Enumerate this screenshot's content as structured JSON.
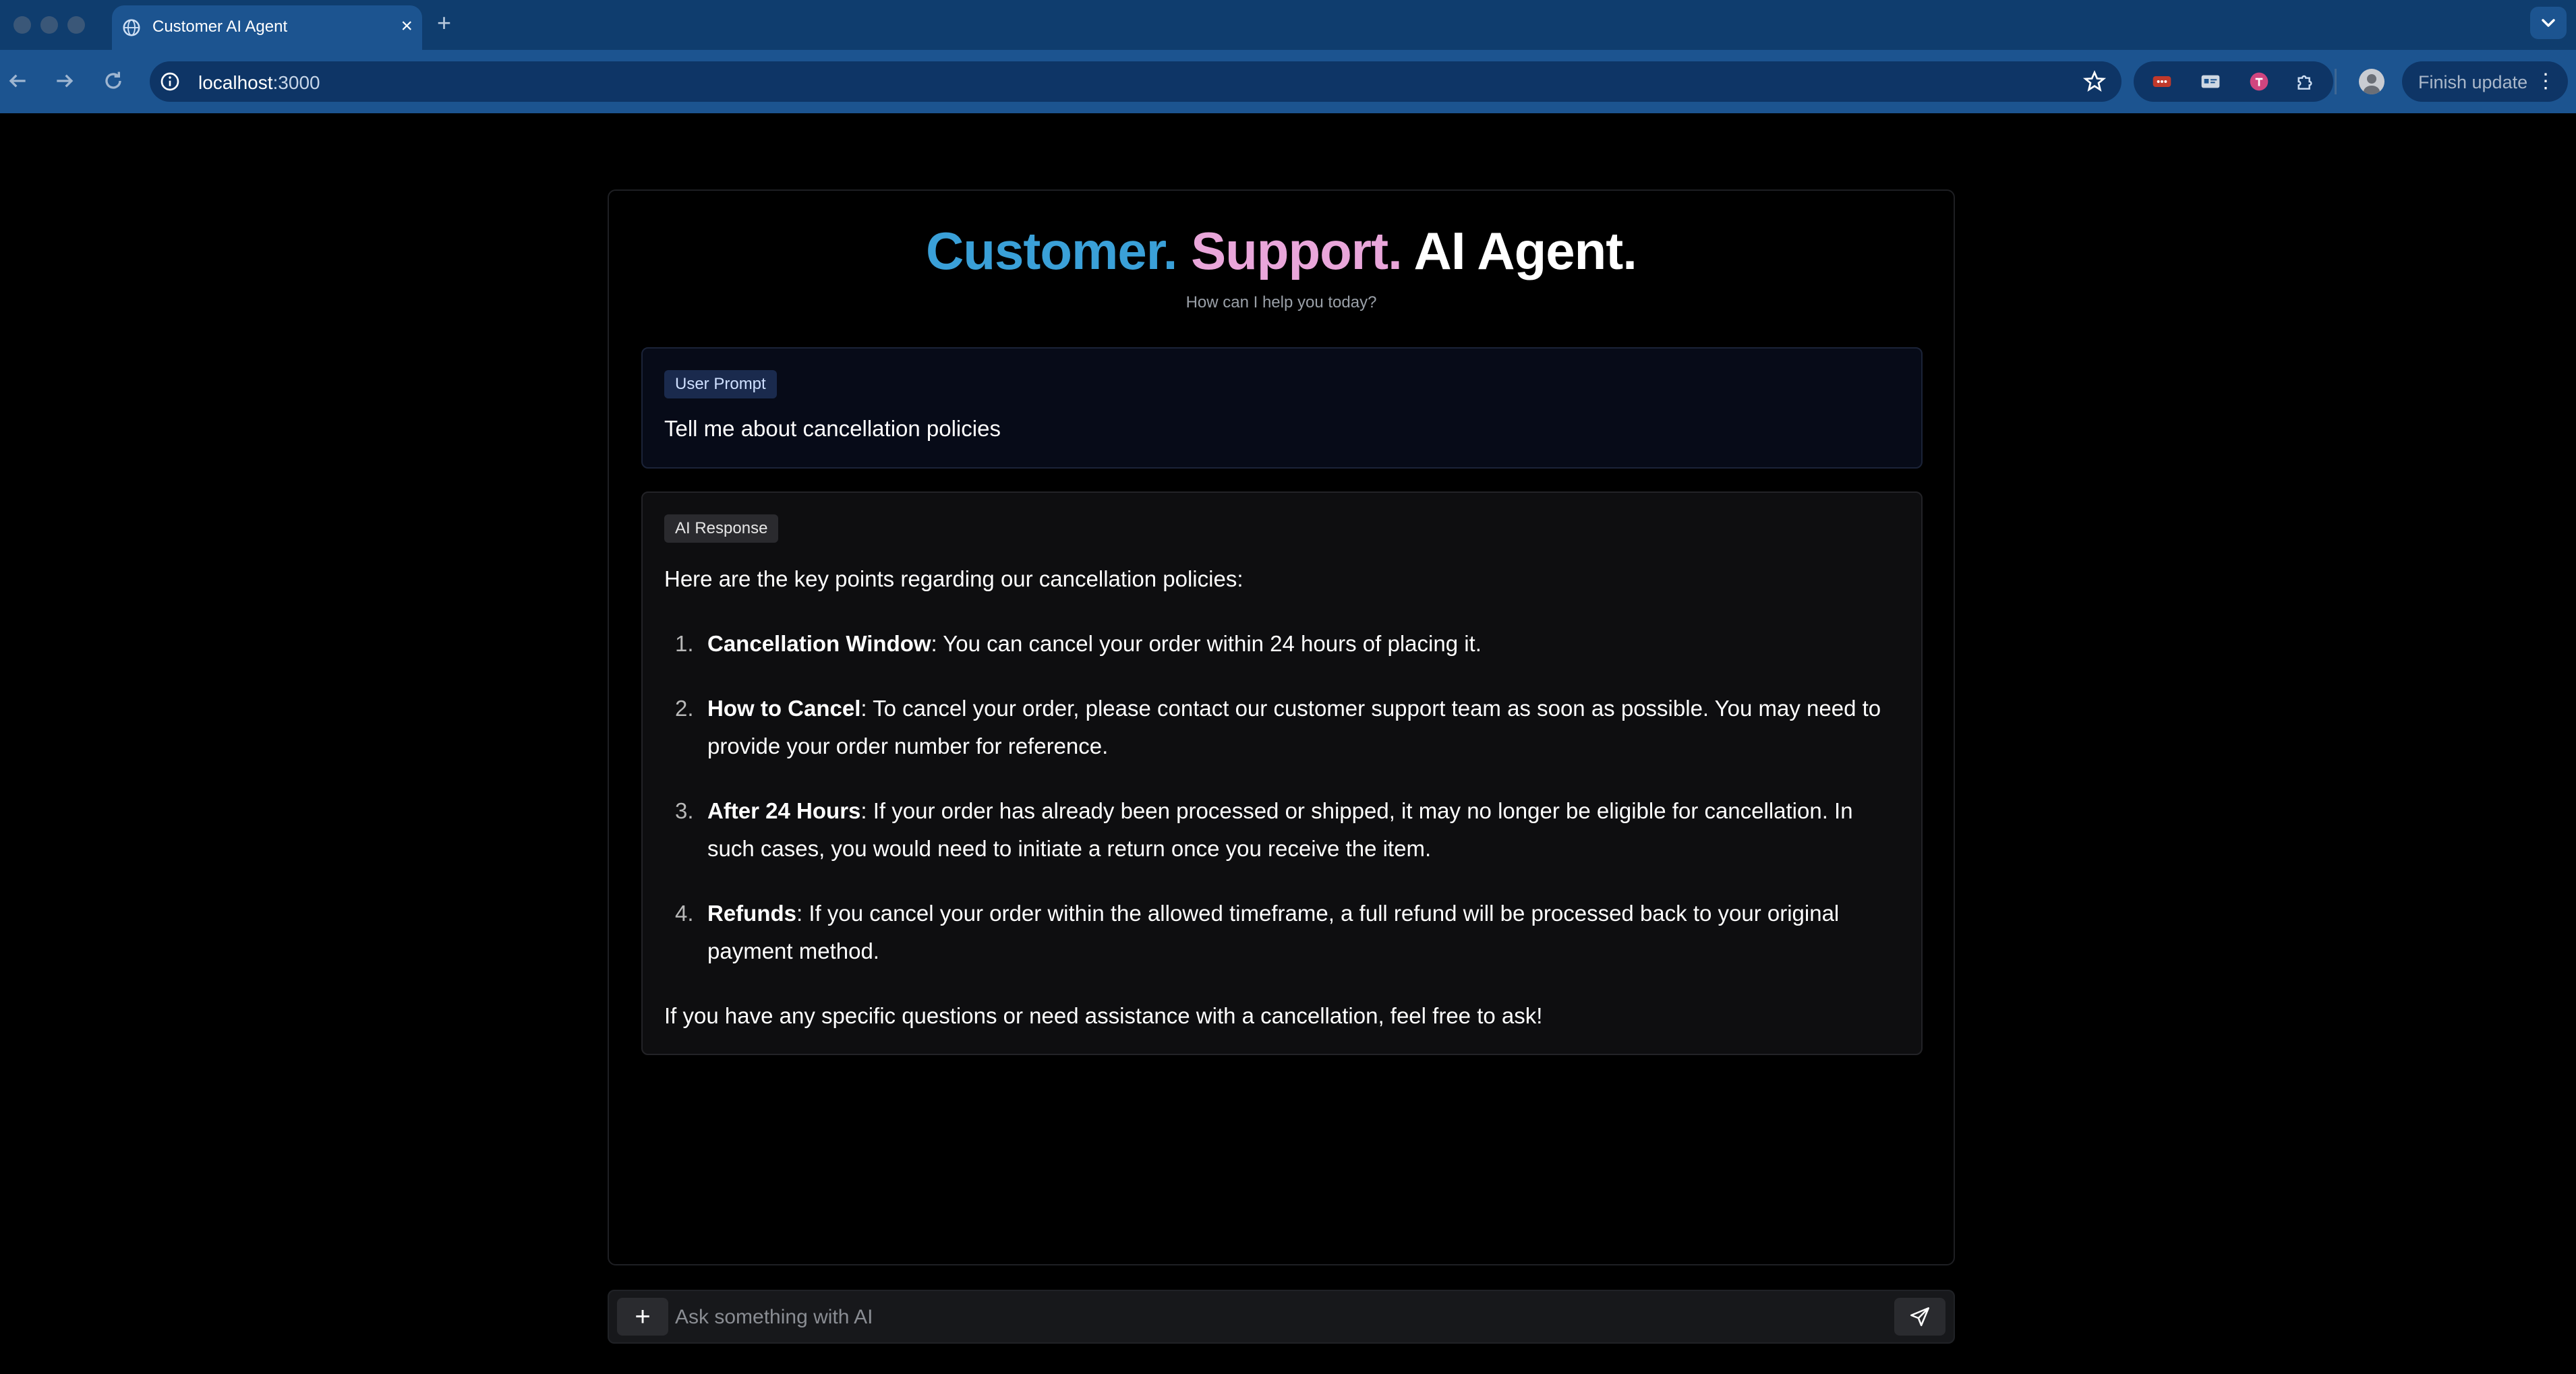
{
  "browser": {
    "tab_title": "Customer AI Agent",
    "new_tab_symbol": "+",
    "close_symbol": "×",
    "url_host": "localhost",
    "url_port": ":3000",
    "finish_update_label": "Finish update",
    "menu_symbol": "⋮"
  },
  "header": {
    "word1": "Customer.",
    "word2": "Support.",
    "word3": "AI Agent.",
    "subtitle": "How can I help you today?"
  },
  "user_message": {
    "badge": "User Prompt",
    "text": "Tell me about cancellation policies"
  },
  "ai_message": {
    "badge": "AI Response",
    "intro": "Here are the key points regarding our cancellation policies:",
    "items": [
      {
        "num": "1.",
        "title": "Cancellation Window",
        "text": ": You can cancel your order within 24 hours of placing it."
      },
      {
        "num": "2.",
        "title": "How to Cancel",
        "text": ": To cancel your order, please contact our customer support team as soon as possible. You may need to provide your order number for reference."
      },
      {
        "num": "3.",
        "title": "After 24 Hours",
        "text": ": If your order has already been processed or shipped, it may no longer be eligible for cancellation. In such cases, you would need to initiate a return once you receive the item."
      },
      {
        "num": "4.",
        "title": "Refunds",
        "text": ": If you cancel your order within the allowed timeframe, a full refund will be processed back to your original payment method."
      }
    ],
    "outro": "If you have any specific questions or need assistance with a cancellation, feel free to ask!"
  },
  "input": {
    "placeholder": "Ask something with AI",
    "plus_symbol": "+"
  },
  "colors": {
    "accent_customer": "#3aa0d8",
    "accent_support": "#e9a6da",
    "chrome_blue": "#1c5490"
  }
}
